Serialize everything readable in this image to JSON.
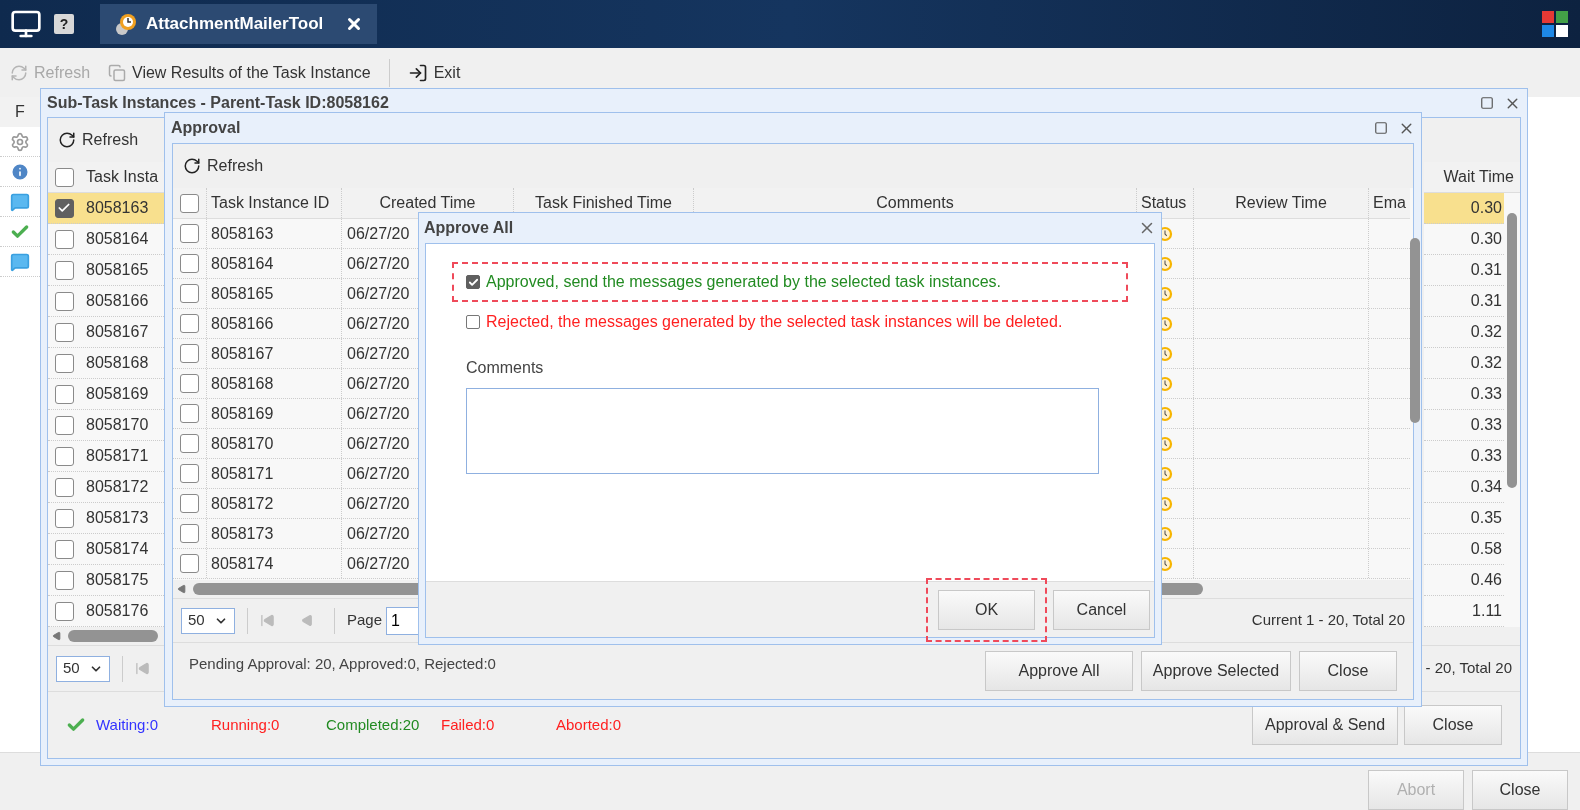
{
  "app": {
    "tabs": [
      {
        "label": "AttachmentMailerTool",
        "selected": true
      }
    ],
    "help_glyph": "?",
    "toolbar": [
      {
        "label": "Refresh",
        "disabled": true
      },
      {
        "label": "View Results of the Task Instance",
        "disabled": false
      },
      {
        "label": "Exit",
        "disabled": false
      }
    ],
    "grid_header": "F",
    "side_icons": [
      {
        "kind": "gear"
      },
      {
        "kind": "info"
      },
      {
        "kind": "chat"
      },
      {
        "kind": "check"
      },
      {
        "kind": "chat"
      }
    ],
    "buttons": [
      {
        "label": "Abort",
        "disabled": true
      },
      {
        "label": "Close",
        "disabled": false
      }
    ]
  },
  "subtask_window": {
    "title": "Sub-Task Instances - Parent-Task ID:8058162",
    "toolbar": [
      "Refresh"
    ],
    "select_all_checked": false,
    "columns": [
      "Task Insta",
      "Wait Time"
    ],
    "rows": [
      {
        "id": "8058163",
        "wait": "0.30",
        "selected": true
      },
      {
        "id": "8058164",
        "wait": "0.30",
        "selected": false
      },
      {
        "id": "8058165",
        "wait": "0.31",
        "selected": false
      },
      {
        "id": "8058166",
        "wait": "0.31",
        "selected": false
      },
      {
        "id": "8058167",
        "wait": "0.32",
        "selected": false
      },
      {
        "id": "8058168",
        "wait": "0.32",
        "selected": false
      },
      {
        "id": "8058169",
        "wait": "0.33",
        "selected": false
      },
      {
        "id": "8058170",
        "wait": "0.33",
        "selected": false
      },
      {
        "id": "8058171",
        "wait": "0.33",
        "selected": false
      },
      {
        "id": "8058172",
        "wait": "0.34",
        "selected": false
      },
      {
        "id": "8058173",
        "wait": "0.35",
        "selected": false
      },
      {
        "id": "8058174",
        "wait": "0.58",
        "selected": false
      },
      {
        "id": "8058175",
        "wait": "0.46",
        "selected": false
      },
      {
        "id": "8058176",
        "wait": "1.11",
        "selected": false
      }
    ],
    "pager": {
      "page_size": "50",
      "summary": "- 20, Total 20"
    },
    "status": [
      {
        "label": "Waiting:0",
        "color": "#3333ff"
      },
      {
        "label": "Running:0",
        "color": "#ff2020"
      },
      {
        "label": "Completed:20",
        "color": "#228b22"
      },
      {
        "label": "Failed:0",
        "color": "#ff2020"
      },
      {
        "label": "Aborted:0",
        "color": "#ff2020"
      }
    ],
    "buttons": [
      "Approval & Send",
      "Close"
    ]
  },
  "approval_window": {
    "title": "Approval",
    "toolbar": [
      "Refresh"
    ],
    "select_all_checked": false,
    "columns": [
      "Task Instance ID",
      "Created Time",
      "Task Finished Time",
      "Comments",
      "Status",
      "Review Time",
      "Ema"
    ],
    "rows": [
      {
        "id": "8058163",
        "created": "06/27/20",
        "checked": false
      },
      {
        "id": "8058164",
        "created": "06/27/20",
        "checked": false
      },
      {
        "id": "8058165",
        "created": "06/27/20",
        "checked": false
      },
      {
        "id": "8058166",
        "created": "06/27/20",
        "checked": false
      },
      {
        "id": "8058167",
        "created": "06/27/20",
        "checked": false
      },
      {
        "id": "8058168",
        "created": "06/27/20",
        "checked": false
      },
      {
        "id": "8058169",
        "created": "06/27/20",
        "checked": false
      },
      {
        "id": "8058170",
        "created": "06/27/20",
        "checked": false
      },
      {
        "id": "8058171",
        "created": "06/27/20",
        "checked": false
      },
      {
        "id": "8058172",
        "created": "06/27/20",
        "checked": false
      },
      {
        "id": "8058173",
        "created": "06/27/20",
        "checked": false
      },
      {
        "id": "8058174",
        "created": "06/27/20",
        "checked": false
      }
    ],
    "pager": {
      "page_size": "50",
      "page_label": "Page",
      "page": "1",
      "summary": "Current 1 - 20, Total 20"
    },
    "footer_text": "Pending Approval: 20, Approved:0, Rejected:0",
    "buttons": [
      "Approve All",
      "Approve Selected",
      "Close"
    ]
  },
  "approve_all_dialog": {
    "title": "Approve All",
    "options": [
      {
        "label": "Approved, send the messages generated by the selected task instances.",
        "checked": true,
        "color": "#228b22",
        "highlighted": true
      },
      {
        "label": "Rejected, the messages generated by the selected task instances will be deleted.",
        "checked": false,
        "color": "#ff2020",
        "highlighted": false
      }
    ],
    "comments_label": "Comments",
    "buttons": [
      {
        "label": "OK",
        "highlighted": true
      },
      {
        "label": "Cancel",
        "highlighted": false
      }
    ]
  }
}
